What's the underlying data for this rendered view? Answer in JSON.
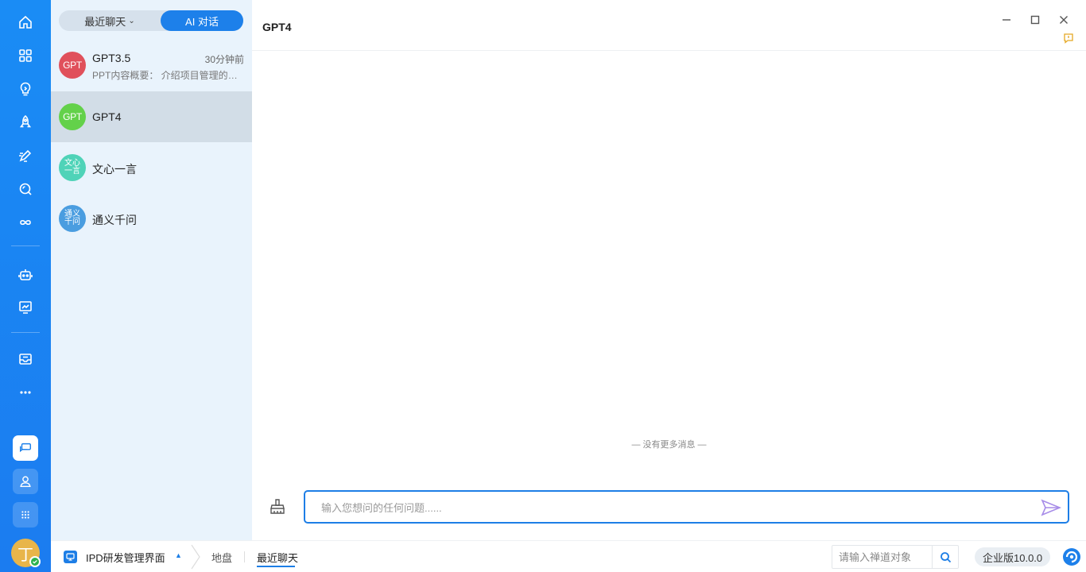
{
  "colors": {
    "rail": "#1a8cf5",
    "accent": "#1d80ea",
    "list_bg": "#e9f3fc",
    "selected_row": "#d2dde7"
  },
  "rail": {
    "top_icons": [
      "home-icon",
      "apps-grid-icon",
      "bulb-icon",
      "rocket-icon",
      "pen-icon",
      "search-icon",
      "infinity-icon"
    ],
    "mid_icons": [
      "robot-icon",
      "presentation-icon"
    ],
    "low_icons": [
      "inbox-icon",
      "more-icon"
    ],
    "bottom_icons": [
      "chat-bubbles-icon",
      "contacts-icon",
      "dots-grid-icon"
    ],
    "avatar_initial": "丁"
  },
  "segment": {
    "recent": "最近聊天",
    "ai": "AI 对话"
  },
  "conversations": [
    {
      "name": "GPT3.5",
      "time": "30分钟前",
      "preview": "PPT内容概要：  介绍项目管理的基本概念和流程",
      "avatar_text": "GPT",
      "avatar_color": "#e0505b",
      "selected": false
    },
    {
      "name": "GPT4",
      "time": "",
      "preview": "",
      "avatar_text": "GPT",
      "avatar_color": "#63d14a",
      "selected": true
    },
    {
      "name": "文心一言",
      "time": "",
      "preview": "",
      "avatar_text_l1": "文心",
      "avatar_text_l2": "一言",
      "avatar_color": "#4fd3b8",
      "selected": false
    },
    {
      "name": "通义千问",
      "time": "",
      "preview": "",
      "avatar_text_l1": "通义",
      "avatar_text_l2": "千问",
      "avatar_color": "#4a9de0",
      "selected": false
    }
  ],
  "chat": {
    "title": "GPT4",
    "no_more": "— 没有更多消息 —",
    "input_placeholder": "输入您想问的任何问题......"
  },
  "statusbar": {
    "workspace": "IPD研发管理界面",
    "crumb_1": "地盘",
    "crumb_2": "最近聊天",
    "zen_placeholder": "请输入禅道对象",
    "edition": "企业版10.0.0"
  }
}
